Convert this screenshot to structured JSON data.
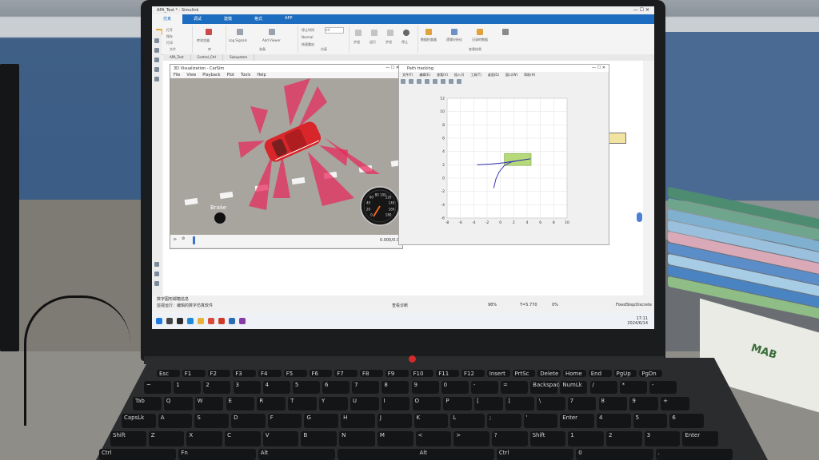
{
  "matlab": {
    "window_title": "APA_Test * - Simulink",
    "ribbon_tabs": [
      "仿真",
      "调试",
      "建模",
      "格式",
      "APP"
    ],
    "ribbon_groups": [
      {
        "label": "文件",
        "items": [
          "打开",
          "保存",
          "打印"
        ]
      },
      {
        "label": "库",
        "items": [
          "库浏览器"
        ]
      },
      {
        "label": "准备",
        "items": [
          "Log Signals",
          "Add Viewer"
        ]
      },
      {
        "label": "仿真",
        "items": [
          "停止时间",
          "Normal",
          "快速重启"
        ]
      },
      {
        "label": "",
        "items": [
          "步退",
          "运行",
          "步进",
          "停止"
        ]
      },
      {
        "label": "查看结果",
        "items": [
          "数据检查器",
          "逻辑分析仪",
          "记录的数据"
        ]
      }
    ],
    "stop_time": "inf",
    "sim_mode": "Normal",
    "model_tabs": [
      "APA_Test",
      "Control_Ctrl",
      "Subsystem"
    ],
    "breadcrumb": "APA_Test",
    "status_left": "就绪",
    "status_middle": "查看诊断",
    "zoom": "98%",
    "sim_time": "T=5.770",
    "solver": "FixedStepDiscrete",
    "percent": "0%",
    "console_line": "数字图形邮箱信息",
    "console_line2": "监视运行：编辑的数字仿真软件",
    "clock": "17:11",
    "date": "2024/6/14"
  },
  "viewer": {
    "title": "3D Visualization - CarSim",
    "menu": [
      "File",
      "View",
      "Playback",
      "Plot",
      "Tools",
      "Help"
    ],
    "brake_label": "Brake",
    "time_readout": "0.000/0.0",
    "speed_ticks": [
      "0",
      "20",
      "40",
      "60",
      "80",
      "100",
      "120",
      "140",
      "160",
      "180"
    ],
    "speed_value": 0
  },
  "plot": {
    "title": "Path tracking",
    "menu": [
      "文件(F)",
      "编辑(E)",
      "查看(V)",
      "插入(I)",
      "工具(T)",
      "桌面(D)",
      "窗口(W)",
      "帮助(H)"
    ]
  },
  "chart_data": {
    "type": "line",
    "title": "",
    "xlabel": "",
    "ylabel": "",
    "xlim": [
      -8,
      10
    ],
    "ylim": [
      -6,
      12
    ],
    "xticks": [
      -8,
      -6,
      -4,
      -2,
      0,
      2,
      4,
      6,
      8,
      10
    ],
    "yticks": [
      -6,
      -4,
      -2,
      0,
      2,
      4,
      6,
      8,
      10,
      12
    ],
    "grid": true,
    "series": [
      {
        "color": "#2b2bb0",
        "x": [
          -3.5,
          -1.5,
          0.5,
          2.5,
          4.5
        ],
        "y": [
          2.0,
          2.1,
          2.3,
          2.6,
          2.9
        ]
      },
      {
        "color": "#3a3ab5",
        "x": [
          -1.0,
          -0.7,
          -0.2,
          0.6,
          1.6,
          2.4
        ],
        "y": [
          -1.5,
          -0.2,
          0.9,
          1.9,
          2.4,
          2.6
        ]
      }
    ],
    "vehicle_box": {
      "x": [
        0.6,
        4.6
      ],
      "y": [
        1.9,
        3.7
      ],
      "color": "#b6d97a"
    }
  },
  "keyboard": {
    "row0": [
      "Esc",
      "F1",
      "F2",
      "F3",
      "F4",
      "F5",
      "F6",
      "F7",
      "F8",
      "F9",
      "F10",
      "F11",
      "F12",
      "Insert",
      "PrtSc",
      "Delete",
      "Home",
      "End",
      "PgUp",
      "PgDn"
    ],
    "row1": [
      "~",
      "1",
      "2",
      "3",
      "4",
      "5",
      "6",
      "7",
      "8",
      "9",
      "0",
      "-",
      "=",
      "Backspace",
      "NumLk",
      "/",
      "*",
      "-"
    ],
    "row2": [
      "Tab",
      "Q",
      "W",
      "E",
      "R",
      "T",
      "Y",
      "U",
      "I",
      "O",
      "P",
      "[",
      "]",
      "\\",
      "7",
      "8",
      "9",
      "+"
    ],
    "row3": [
      "CapsLk",
      "A",
      "S",
      "D",
      "F",
      "G",
      "H",
      "J",
      "K",
      "L",
      ";",
      "'",
      "Enter",
      "4",
      "5",
      "6"
    ],
    "row4": [
      "Shift",
      "Z",
      "X",
      "C",
      "V",
      "B",
      "N",
      "M",
      "<",
      ">",
      "?",
      "Shift",
      "1",
      "2",
      "3",
      "Enter"
    ],
    "row5": [
      "Ctrl",
      "Fn",
      "Alt",
      "",
      "Alt",
      "Ctrl",
      "0",
      "."
    ]
  },
  "book": {
    "spine_text": "MAB"
  },
  "colors": {
    "ribbon_blue": "#1c6cbf",
    "sensor_red": "#e8285a",
    "car_red": "#d8262a",
    "asphalt": "#a8a49e"
  }
}
